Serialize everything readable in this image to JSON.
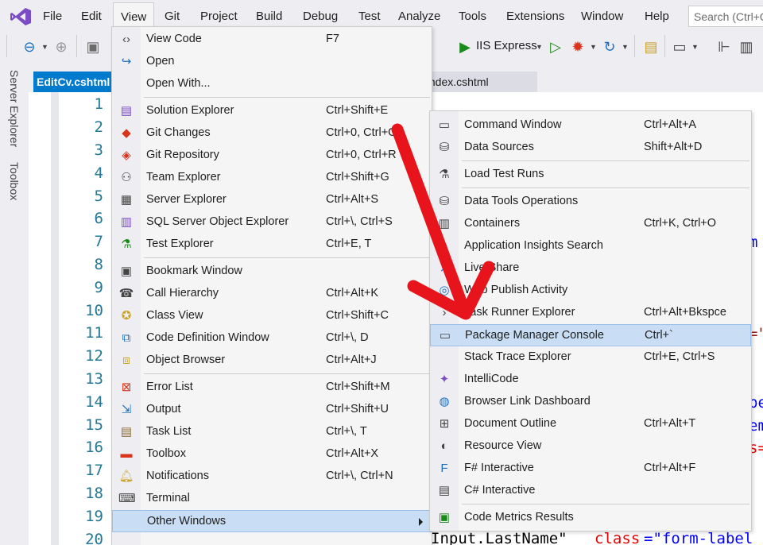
{
  "menubar": {
    "items": [
      "File",
      "Edit",
      "View",
      "Git",
      "Project",
      "Build",
      "Debug",
      "Test",
      "Analyze",
      "Tools",
      "Extensions",
      "Window",
      "Help"
    ],
    "search_placeholder": "Search (Ctrl+Q)"
  },
  "toolbar": {
    "run_target": "IIS Express"
  },
  "side_tabs": [
    "Server Explorer",
    "Toolbox"
  ],
  "tabs": {
    "active": "EditCv.cshtml",
    "inactive": "Index.cshtml"
  },
  "editor": {
    "line_numbers": [
      "1",
      "2",
      "3",
      "4",
      "5",
      "6",
      "7",
      "8",
      "9",
      "10",
      "11",
      "12",
      "13",
      "14",
      "15",
      "16",
      "17",
      "18",
      "19",
      "20"
    ],
    "visible_code": {
      "l7": "m",
      "l11": "=\"",
      "l14": "pe",
      "l15": "em",
      "l16": "s=",
      "l20_a": "Input.LastName\"",
      "l20_b": "class",
      "l20_c": "=\"form-label"
    }
  },
  "view_menu": {
    "items": [
      {
        "label": "View Code",
        "shortcut": "F7",
        "icon": "code-icon"
      },
      {
        "label": "Open",
        "shortcut": "",
        "icon": "open-arrow-icon"
      },
      {
        "label": "Open With...",
        "shortcut": "",
        "icon": ""
      },
      {
        "label": "Solution Explorer",
        "shortcut": "Ctrl+Shift+E",
        "icon": "solution-explorer-icon"
      },
      {
        "label": "Git Changes",
        "shortcut": "Ctrl+0, Ctrl+G",
        "icon": "git-changes-icon"
      },
      {
        "label": "Git Repository",
        "shortcut": "Ctrl+0, Ctrl+R",
        "icon": "git-repository-icon"
      },
      {
        "label": "Team Explorer",
        "shortcut": "Ctrl+Shift+G",
        "icon": "team-explorer-icon"
      },
      {
        "label": "Server Explorer",
        "shortcut": "Ctrl+Alt+S",
        "icon": "server-explorer-icon"
      },
      {
        "label": "SQL Server Object Explorer",
        "shortcut": "Ctrl+\\, Ctrl+S",
        "icon": "sql-server-icon"
      },
      {
        "label": "Test Explorer",
        "shortcut": "Ctrl+E, T",
        "icon": "test-explorer-icon"
      },
      {
        "label": "Bookmark Window",
        "shortcut": "",
        "icon": "bookmark-icon"
      },
      {
        "label": "Call Hierarchy",
        "shortcut": "Ctrl+Alt+K",
        "icon": "call-hierarchy-icon"
      },
      {
        "label": "Class View",
        "shortcut": "Ctrl+Shift+C",
        "icon": "class-view-icon"
      },
      {
        "label": "Code Definition Window",
        "shortcut": "Ctrl+\\, D",
        "icon": "code-definition-icon"
      },
      {
        "label": "Object Browser",
        "shortcut": "Ctrl+Alt+J",
        "icon": "object-browser-icon"
      },
      {
        "label": "Error List",
        "shortcut": "Ctrl+Shift+M",
        "icon": "error-list-icon"
      },
      {
        "label": "Output",
        "shortcut": "Ctrl+Shift+U",
        "icon": "output-icon"
      },
      {
        "label": "Task List",
        "shortcut": "Ctrl+\\, T",
        "icon": "task-list-icon"
      },
      {
        "label": "Toolbox",
        "shortcut": "Ctrl+Alt+X",
        "icon": "toolbox-icon"
      },
      {
        "label": "Notifications",
        "shortcut": "Ctrl+\\, Ctrl+N",
        "icon": "bell-icon"
      },
      {
        "label": "Terminal",
        "shortcut": "",
        "icon": "terminal-icon"
      },
      {
        "label": "Other Windows",
        "shortcut": "",
        "icon": ""
      }
    ]
  },
  "other_windows_menu": {
    "items": [
      {
        "label": "Command Window",
        "shortcut": "Ctrl+Alt+A",
        "icon": "command-window-icon"
      },
      {
        "label": "Data Sources",
        "shortcut": "Shift+Alt+D",
        "icon": "data-sources-icon"
      },
      {
        "label": "Load Test Runs",
        "shortcut": "",
        "icon": "load-test-icon"
      },
      {
        "label": "Data Tools Operations",
        "shortcut": "",
        "icon": "data-tools-icon"
      },
      {
        "label": "Containers",
        "shortcut": "Ctrl+K, Ctrl+O",
        "icon": "containers-icon"
      },
      {
        "label": "Application Insights Search",
        "shortcut": "",
        "icon": "app-insights-icon"
      },
      {
        "label": "Live Share",
        "shortcut": "",
        "icon": "live-share-icon"
      },
      {
        "label": "Web Publish Activity",
        "shortcut": "",
        "icon": "web-publish-icon"
      },
      {
        "label": "Task Runner Explorer",
        "shortcut": "Ctrl+Alt+Bkspce",
        "icon": "task-runner-icon"
      },
      {
        "label": "Package Manager Console",
        "shortcut": "Ctrl+`",
        "icon": "package-manager-icon"
      },
      {
        "label": "Stack Trace Explorer",
        "shortcut": "Ctrl+E, Ctrl+S",
        "icon": ""
      },
      {
        "label": "IntelliCode",
        "shortcut": "",
        "icon": "intellicode-icon"
      },
      {
        "label": "Browser Link Dashboard",
        "shortcut": "",
        "icon": "globe-icon"
      },
      {
        "label": "Document Outline",
        "shortcut": "Ctrl+Alt+T",
        "icon": "document-outline-icon"
      },
      {
        "label": "Resource View",
        "shortcut": "",
        "icon": "resource-view-icon"
      },
      {
        "label": "F# Interactive",
        "shortcut": "Ctrl+Alt+F",
        "icon": "fsharp-icon"
      },
      {
        "label": "C# Interactive",
        "shortcut": "",
        "icon": "csharp-icon"
      },
      {
        "label": "Code Metrics Results",
        "shortcut": "",
        "icon": "code-metrics-icon"
      }
    ]
  },
  "colors": {
    "accent": "#007acc",
    "highlight": "#c9def5",
    "annotation_arrow": "#e8141b"
  }
}
